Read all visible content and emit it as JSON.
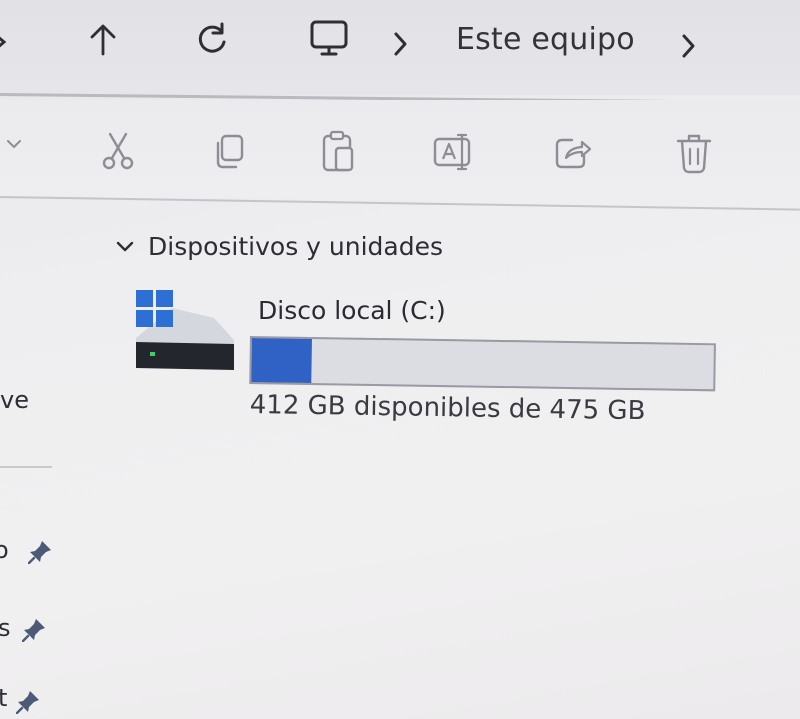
{
  "address_bar": {
    "location": "Este equipo",
    "icons": [
      "back-arrow-icon",
      "up-arrow-icon",
      "refresh-icon",
      "monitor-icon",
      "chevron-right-icon",
      "chevron-right-icon"
    ]
  },
  "command_bar": {
    "icons": [
      "chevron-down-icon",
      "cut-icon",
      "copy-icon",
      "paste-icon",
      "rename-icon",
      "share-icon",
      "delete-icon"
    ]
  },
  "content": {
    "section_title": "Dispositivos y unidades",
    "drives": [
      {
        "name": "Disco local (C:)",
        "space_text": "412 GB disponibles de 475 GB",
        "used_fraction": 0.13,
        "bar_color": "#2f62c4"
      }
    ]
  },
  "nav_pane": {
    "fragments": [
      "ve",
      "o",
      "s",
      "t"
    ]
  }
}
